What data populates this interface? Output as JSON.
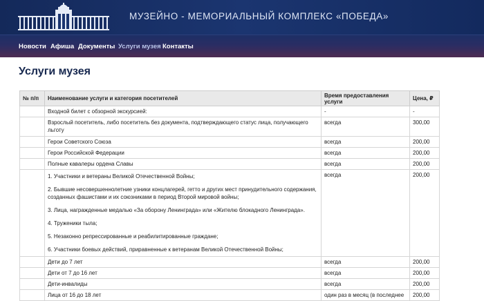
{
  "header": {
    "site_title": "МУЗЕЙНО - МЕМОРИАЛЬНЫЙ КОМПЛЕКС «ПОБЕДА»"
  },
  "nav": {
    "items": [
      {
        "label": "Новости",
        "active": false
      },
      {
        "label": "Афиша",
        "active": false
      },
      {
        "label": "Документы",
        "active": false
      },
      {
        "label": "Услуги музея",
        "active": true
      },
      {
        "label": "Контакты",
        "active": false
      }
    ]
  },
  "page": {
    "title": "Услуги музея"
  },
  "table": {
    "headers": [
      "№ п/п",
      "Наименование услуги и категория посетителей",
      "Время предоставления услуги",
      "Цена, ₽"
    ],
    "rows": [
      {
        "num": "",
        "name": "Входной билет с обзорной экскурсией:",
        "time": "-",
        "price": "-"
      },
      {
        "num": "",
        "name": "Взрослый посетитель, либо посетитель без документа, подтверждающего статус лица, получающего льготу",
        "time": "всегда",
        "price": "300,00"
      },
      {
        "num": "",
        "name": "Герои Советского Союза",
        "time": "всегда",
        "price": "200,00"
      },
      {
        "num": "",
        "name": "Герои Российской Федерации",
        "time": "всегда",
        "price": "200,00"
      },
      {
        "num": "",
        "name": "Полные кавалеры ордена Славы",
        "time": "всегда",
        "price": "200,00"
      },
      {
        "num": "",
        "name_list": [
          "1. Участники и ветераны Великой Отечественной Войны;",
          "2. Бывшие несовершеннолетние узники концлагерей, гетто и других мест принудительного содержания, созданных фашистами и их союзниками в период Второй мировой войны;",
          "3. Лица, награжденные медалью «За оборону Ленинграда» или «Жителю блокадного Ленинграда».",
          "4. Труженики тыла;",
          "5. Незаконно репрессированные и реабилитированные граждане;",
          "6. Участники боевых действий, приравненные к ветеранам Великой Отечественной Войны;"
        ],
        "time": "всегда",
        "price": "200,00"
      },
      {
        "num": "",
        "name": "Дети до 7 лет",
        "time": "всегда",
        "price": "200,00"
      },
      {
        "num": "",
        "name": "Дети от 7 до 16 лет",
        "time": "всегда",
        "price": "200,00"
      },
      {
        "num": "",
        "name": "Дети-инвалиды",
        "time": "всегда",
        "price": "200,00"
      },
      {
        "num": "",
        "name": "Лица от 16 до 18 лет",
        "time": "один раз в месяц (в последнее",
        "price": "200,00"
      }
    ]
  }
}
